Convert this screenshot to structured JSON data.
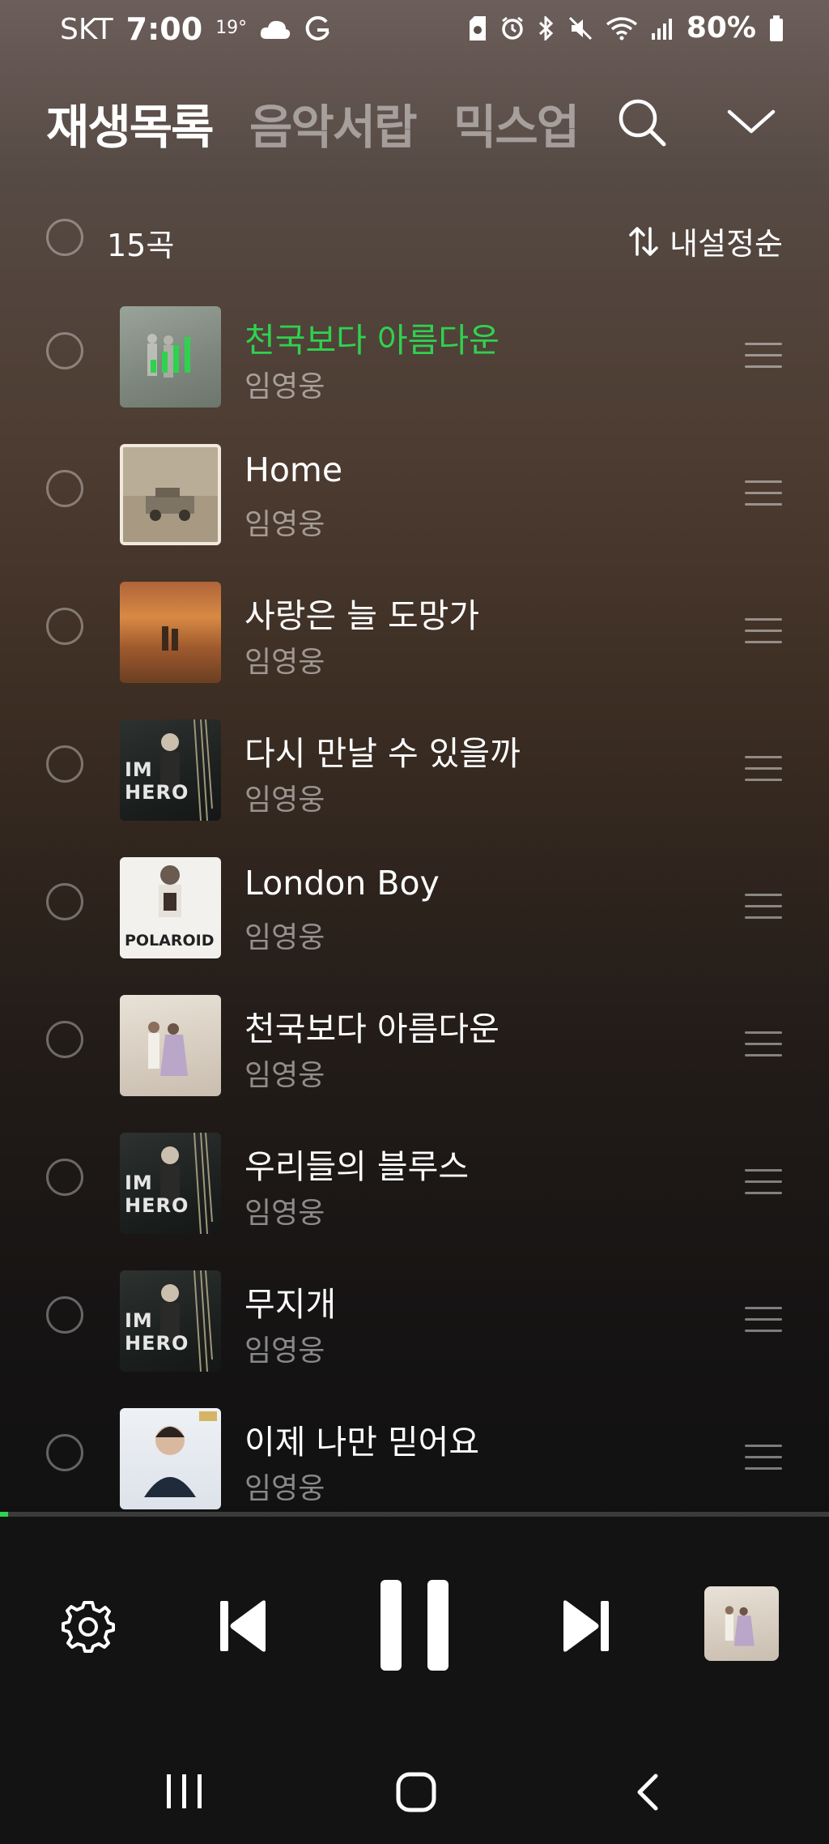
{
  "status_bar": {
    "carrier": "SKT",
    "time": "7:00",
    "temperature": "19°",
    "battery": "80%"
  },
  "header": {
    "tabs": [
      {
        "label": "재생목록",
        "active": true
      },
      {
        "label": "음악서랍",
        "active": false
      },
      {
        "label": "믹스업",
        "active": false
      }
    ],
    "icons": [
      "search-icon",
      "chevron-down-icon"
    ]
  },
  "list": {
    "count": "15곡",
    "sort_label": "내설정순",
    "accent_color": "#2fd24e",
    "tracks": [
      {
        "title": "천국보다 아름다운",
        "artist": "임영웅",
        "playing": true
      },
      {
        "title": "Home",
        "artist": "임영웅",
        "playing": false
      },
      {
        "title": "사랑은 늘 도망가",
        "artist": "임영웅",
        "playing": false
      },
      {
        "title": "다시 만날 수 있을까",
        "artist": "임영웅",
        "playing": false
      },
      {
        "title": "London Boy",
        "artist": "임영웅",
        "playing": false
      },
      {
        "title": "천국보다 아름다운",
        "artist": "임영웅",
        "playing": false
      },
      {
        "title": "우리들의 블루스",
        "artist": "임영웅",
        "playing": false
      },
      {
        "title": "무지개",
        "artist": "임영웅",
        "playing": false
      },
      {
        "title": "이제 나만 믿어요",
        "artist": "임영웅",
        "playing": false
      }
    ],
    "album_art_text": {
      "im_hero": "IM HERO",
      "polaroid": "POLAROID"
    }
  },
  "player": {
    "progress": 0.01,
    "controls": [
      "settings-icon",
      "previous-icon",
      "pause-icon",
      "next-icon"
    ]
  },
  "nav_bar": {
    "icons": [
      "recent-apps-icon",
      "home-icon",
      "back-icon"
    ]
  }
}
